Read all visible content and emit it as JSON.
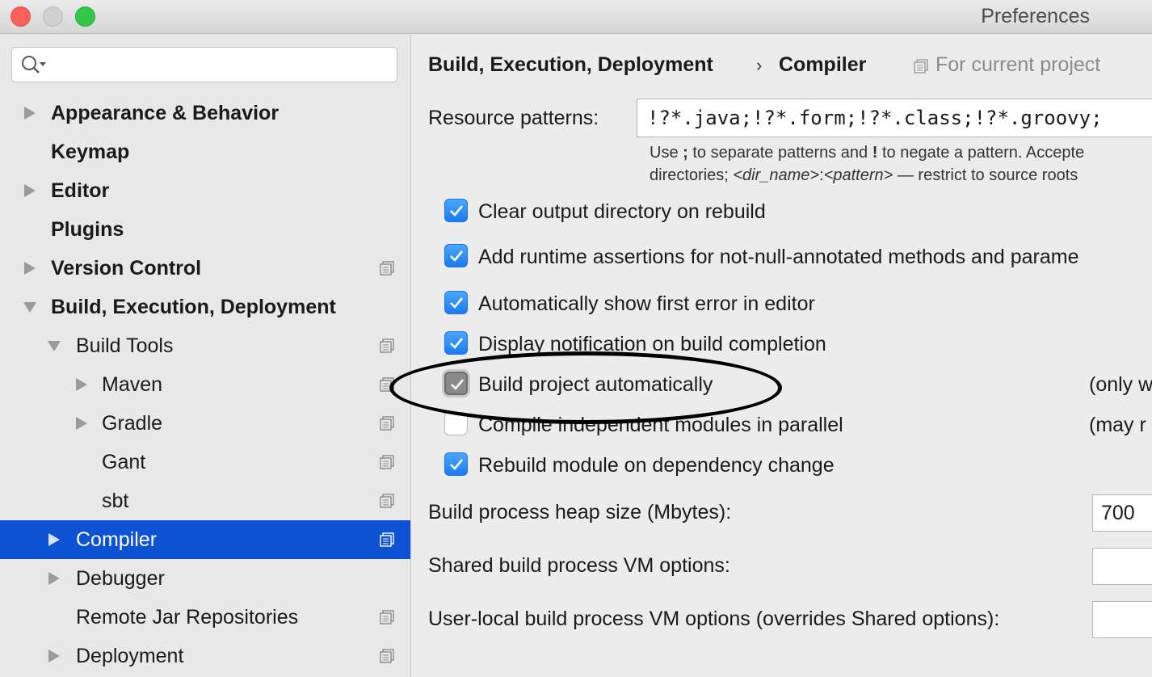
{
  "window": {
    "title": "Preferences"
  },
  "sidebar": {
    "search": {
      "value": "",
      "placeholder": ""
    },
    "items": [
      {
        "label": "Appearance & Behavior",
        "arrow": "right"
      },
      {
        "label": "Keymap",
        "arrow": ""
      },
      {
        "label": "Editor",
        "arrow": "right"
      },
      {
        "label": "Plugins",
        "arrow": ""
      },
      {
        "label": "Version Control",
        "arrow": "right"
      },
      {
        "label": "Build, Execution, Deployment",
        "arrow": "down"
      },
      {
        "label": "Build Tools",
        "arrow": "down"
      },
      {
        "label": "Maven",
        "arrow": "right"
      },
      {
        "label": "Gradle",
        "arrow": "right"
      },
      {
        "label": "Gant",
        "arrow": ""
      },
      {
        "label": "sbt",
        "arrow": ""
      },
      {
        "label": "Compiler",
        "arrow": "right",
        "selected": true
      },
      {
        "label": "Debugger",
        "arrow": "right"
      },
      {
        "label": "Remote Jar Repositories",
        "arrow": ""
      },
      {
        "label": "Deployment",
        "arrow": "right"
      }
    ]
  },
  "main": {
    "breadcrumb": {
      "parent": "Build, Execution, Deployment",
      "separator": "›",
      "current": "Compiler"
    },
    "scope_label": "For current project",
    "resource_patterns": {
      "label": "Resource patterns:",
      "value": "!?*.java;!?*.form;!?*.class;!?*.groovy;",
      "hint_line1": {
        "pre": "Use ",
        "b1": ";",
        "mid": " to separate patterns and ",
        "b2": "!",
        "post": " to negate a pattern. Accepte"
      },
      "hint_line2": {
        "pre": "directories; ",
        "i1": "<dir_name>",
        "mid": ":",
        "i2": "<pattern>",
        "post": " — restrict to source roots"
      }
    },
    "checkboxes": [
      {
        "label": "Clear output directory on rebuild",
        "checked": true
      },
      {
        "label": "Add runtime assertions for not-null-annotated methods and parame",
        "checked": true
      },
      {
        "label": "Automatically show first error in editor",
        "checked": true
      },
      {
        "label": "Display notification on build completion",
        "checked": true
      },
      {
        "label": "Build project automatically",
        "checked": true,
        "note": "(only w"
      },
      {
        "label": "Compile independent modules in parallel",
        "checked": false,
        "note": "(may r"
      },
      {
        "label": "Rebuild module on dependency change",
        "checked": true
      }
    ],
    "fields": {
      "heap_label": "Build process heap size (Mbytes):",
      "heap_value": "700",
      "shared_label": "Shared build process VM options:",
      "shared_value": "",
      "user_label": "User-local build process VM options (overrides Shared options):",
      "user_value": ""
    }
  },
  "colors": {
    "selection": "#0d52d3",
    "checkbox": "#1b7bf2"
  }
}
